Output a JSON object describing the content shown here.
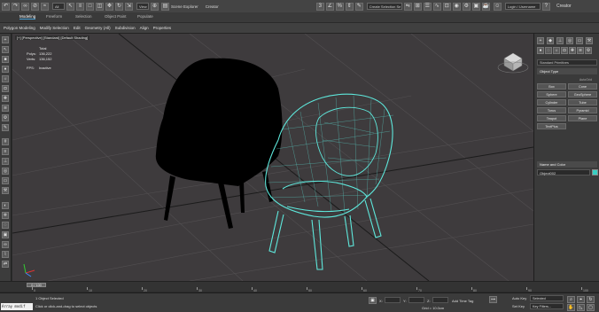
{
  "window": {
    "scene_explorer_label": "Scene Explorer",
    "creator_label": "Creator",
    "workspace_label": "Workspaces: Default",
    "selection_set_label": "Create Selection Se",
    "user_label": "Login / Username",
    "top_right_label": "Creator"
  },
  "ribbon": {
    "tabs": [
      "Modeling",
      "Freeform",
      "Selection",
      "Object Paint",
      "Populate"
    ],
    "active_tab": "Modeling",
    "row_items": [
      "Polygon Modeling",
      "Modify Selection",
      "Edit",
      "Geometry (All)",
      "Subdivision",
      "Align",
      "Properties"
    ]
  },
  "viewport": {
    "label": "[+] [Perspective] [Standard] [Default Shading]",
    "stats": {
      "header": "Total",
      "polys_label": "Polys:",
      "polys_value": "136,222",
      "verts_label": "Verts:",
      "verts_value": "136,152",
      "fps_label": "FPS:",
      "fps_value": "Inactive"
    }
  },
  "command_panel": {
    "category_dropdown": "Standard Primitives",
    "object_type_header": "Object Type",
    "autogrid_label": "AutoGrid",
    "primitives": [
      "Box",
      "Cone",
      "Sphere",
      "GeoSphere",
      "Cylinder",
      "Tube",
      "Torus",
      "Pyramid",
      "Teapot",
      "Plane",
      "TextPlus"
    ],
    "name_color_header": "Name and Color",
    "object_name": "Object002",
    "swatch_color": "#39d0c3"
  },
  "timeline": {
    "slider_label": "0 / 100",
    "ticks": [
      "0",
      "10",
      "20",
      "30",
      "40",
      "50",
      "60",
      "70",
      "80",
      "90",
      "100"
    ]
  },
  "statusbar": {
    "listener_text": "Array modif",
    "selected_text": "1 Object Selected",
    "prompt_text": "Click or click-and-drag to select objects",
    "x_label": "X:",
    "y_label": "Y:",
    "z_label": "Z:",
    "grid_text": "Grid = 10.0cm",
    "add_time_tag": "Add Time Tag",
    "autokey_label": "Auto Key",
    "selected_dropdown": "Selected",
    "setkey_label": "Set Key",
    "key_filters": "Key Filters..."
  },
  "scene": {
    "wire_color": "#5ee8dc",
    "shadow_color": "#000000",
    "bg_color": "#3e3b3d"
  }
}
